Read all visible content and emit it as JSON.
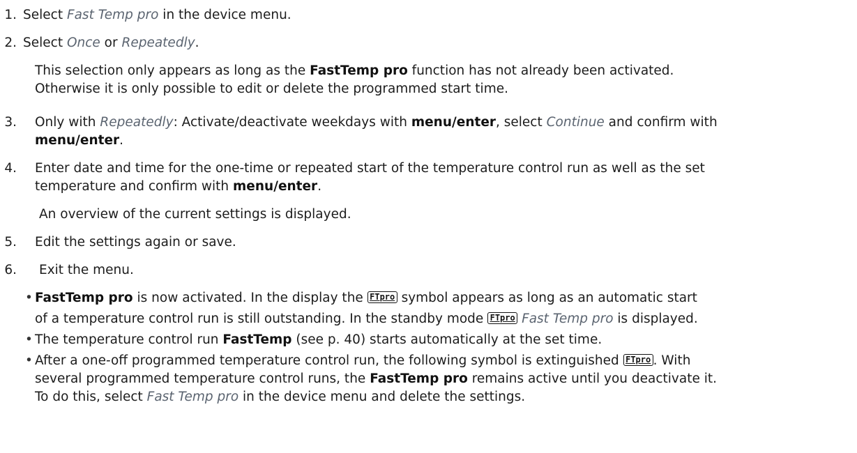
{
  "steps": [
    {
      "num": "1.",
      "parts": [
        "Select ",
        "Fast Temp pro",
        " in the device menu."
      ]
    },
    {
      "num": "2.",
      "parts": [
        "Select ",
        "Once",
        " or ",
        "Repeatedly",
        "."
      ]
    },
    {
      "num": "3.",
      "parts": [
        "Only with ",
        "Repeatedly",
        ": Activate/deactivate weekdays with ",
        "menu/enter",
        ", select ",
        "Continue",
        " and confirm with"
      ],
      "cont": [
        "menu/enter",
        "."
      ]
    },
    {
      "num": "4.",
      "line1": "Enter date and time for the one-time or repeated start of the temperature control run as well as the set",
      "line2_parts": [
        "temperature and confirm with ",
        "menu/enter",
        "."
      ]
    },
    {
      "num": "5.",
      "text": "Edit the settings again or save."
    },
    {
      "num": "6.",
      "text": "Exit the menu."
    }
  ],
  "note2": {
    "parts": [
      "This selection only appears as long as the ",
      "FastTemp pro",
      " function has not already been activated."
    ],
    "line2": "Otherwise it is only possible to edit or delete the programmed start time."
  },
  "result4": "An overview of the current settings is displayed.",
  "symbol_label": "FTpro",
  "results": {
    "r1": {
      "parts": [
        "FastTemp pro",
        " is now activated. In the display the ",
        " symbol appears as long as an automatic start"
      ],
      "line2_parts": [
        "of a temperature control run is still outstanding. In the standby mode ",
        "Fast Temp pro",
        " is displayed."
      ]
    },
    "r2": {
      "parts": [
        "The temperature control run ",
        "FastTemp",
        " (see p. 40) starts automatically at the set time."
      ]
    },
    "r3": {
      "line1": "After a one-off programmed temperature control run, the following symbol is extinguished",
      "line2_parts": [
        "several programmed temperature control runs, the ",
        "FastTemp pro",
        " remains active until you deactivate it."
      ],
      "line3_parts": [
        "To do this, select ",
        "Fast Temp pro",
        " in the device menu and delete the settings."
      ],
      "with": ". With"
    }
  },
  "bullet_char": "•"
}
